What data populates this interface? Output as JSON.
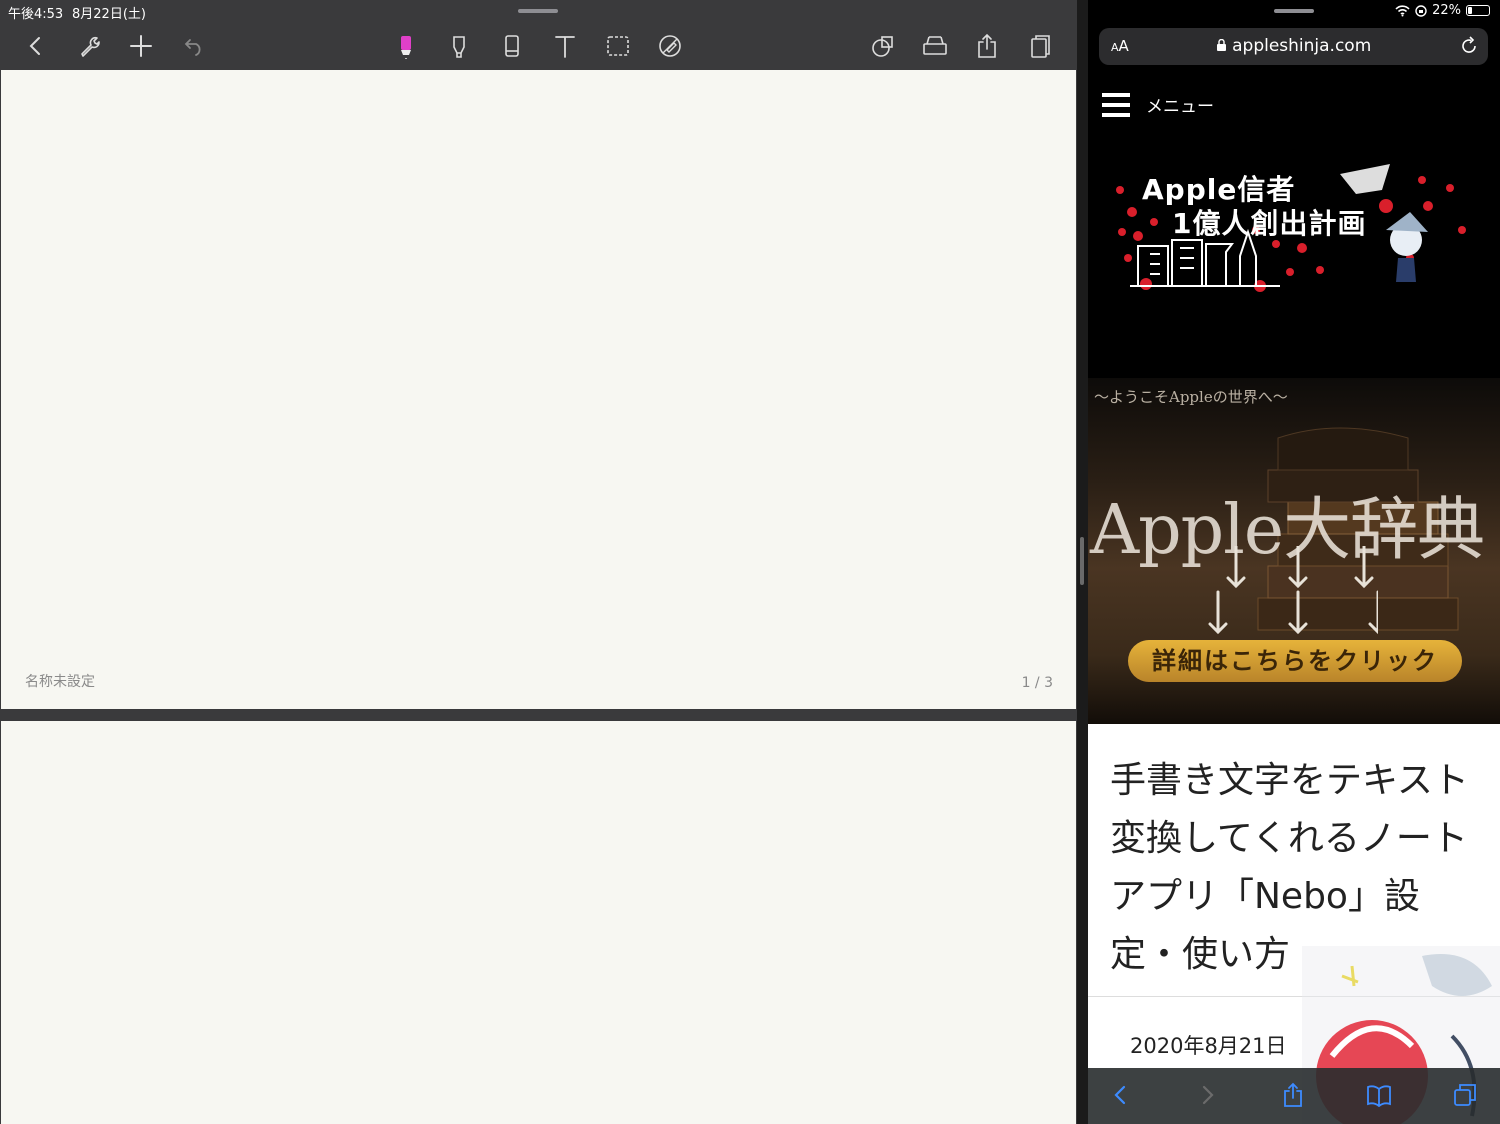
{
  "left_app": {
    "status": {
      "time": "午後4:53",
      "date": "8月22日(土)"
    },
    "toolbar": {
      "back_icon": "chevron-left-icon",
      "settings_icon": "wrench-icon",
      "add_icon": "plus-icon",
      "undo_icon": "undo-icon",
      "tools": [
        "highlighter-pen-icon",
        "marker-icon",
        "eraser-icon",
        "text-tool-icon",
        "lasso-select-icon",
        "no-pen-icon"
      ],
      "right_tools": [
        "shapes-icon",
        "ruler-icon",
        "share-icon",
        "pages-icon"
      ],
      "active_tool_color": "#e040c8"
    },
    "page": {
      "name": "名称未設定",
      "count": "1 / 3"
    }
  },
  "right_app": {
    "status": {
      "battery": "22%",
      "battery_level": 0.22
    },
    "address_bar": {
      "aa_small": "A",
      "aa_large": "A",
      "url": "appleshinja.com"
    },
    "site": {
      "menu_label": "メニュー",
      "banner_line1": "Apple信者",
      "banner_line2": "1億人創出計画",
      "hero_tagline": "〜ようこそAppleの世界へ〜",
      "hero_title": "Apple大辞典",
      "cta_label": "詳細はこちらをクリック"
    },
    "article": {
      "title": "手書き文字をテキスト変換してくれるノートアプリ「Nebo」設定・使い方",
      "date": "2020年8月21日"
    },
    "bottom_toolbar": [
      "back-icon",
      "forward-icon",
      "share-icon",
      "bookmarks-icon",
      "tabs-icon"
    ]
  }
}
